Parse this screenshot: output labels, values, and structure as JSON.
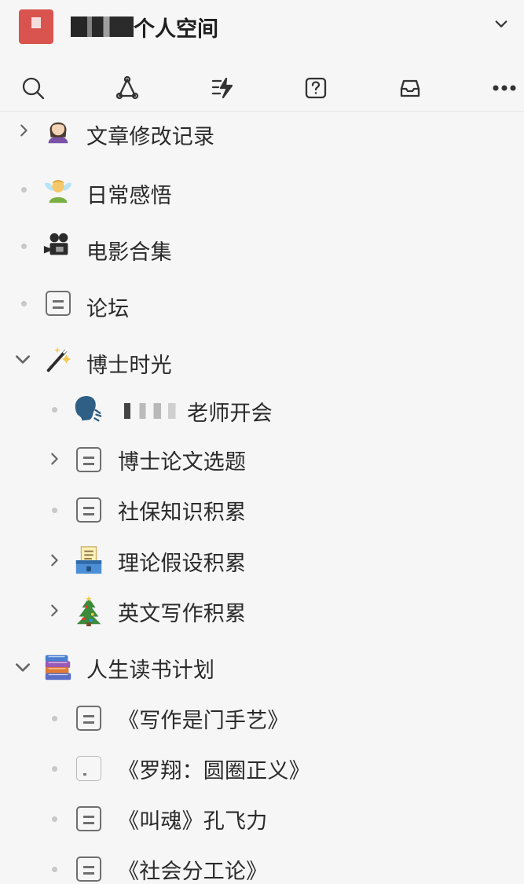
{
  "header": {
    "space_title_visible": "个人空间",
    "chevron_icon": "chevron-down-icon"
  },
  "toolbar": {
    "tools": [
      {
        "name": "search-icon"
      },
      {
        "name": "graph-icon"
      },
      {
        "name": "quick-actions-icon"
      },
      {
        "name": "help-icon"
      },
      {
        "name": "inbox-icon"
      },
      {
        "name": "more-icon"
      }
    ]
  },
  "tree": {
    "items": [
      {
        "label": "文章修改记录",
        "icon": "woman-emoji",
        "toggle": "chevron-right"
      },
      {
        "label": "日常感悟",
        "icon": "fairy-emoji",
        "toggle": "dot"
      },
      {
        "label": "电影合集",
        "icon": "movie-camera-emoji",
        "toggle": "dot"
      },
      {
        "label": "论坛",
        "icon": "document-icon",
        "toggle": "dot"
      },
      {
        "label": "博士时光",
        "icon": "magic-wand-emoji",
        "toggle": "chevron-down"
      },
      {
        "label": "老师开会",
        "icon": "speaking-head-emoji",
        "toggle": "dot"
      },
      {
        "label": "博士论文选题",
        "icon": "document-icon",
        "toggle": "chevron-right"
      },
      {
        "label": "社保知识积累",
        "icon": "document-icon",
        "toggle": "dot"
      },
      {
        "label": "理论假设积累",
        "icon": "ballot-box-emoji",
        "toggle": "chevron-right"
      },
      {
        "label": "英文写作积累",
        "icon": "christmas-tree-emoji",
        "toggle": "chevron-right"
      },
      {
        "label": "人生读书计划",
        "icon": "books-emoji",
        "toggle": "chevron-down"
      },
      {
        "label": "《写作是门手艺》",
        "icon": "document-icon",
        "toggle": "dot"
      },
      {
        "label": "《罗翔：圆圈正义》",
        "icon": "blank-document-icon",
        "toggle": "dot"
      },
      {
        "label": "《叫魂》孔飞力",
        "icon": "document-icon",
        "toggle": "dot"
      },
      {
        "label": "《社会分工论》",
        "icon": "document-icon",
        "toggle": "dot"
      }
    ]
  }
}
